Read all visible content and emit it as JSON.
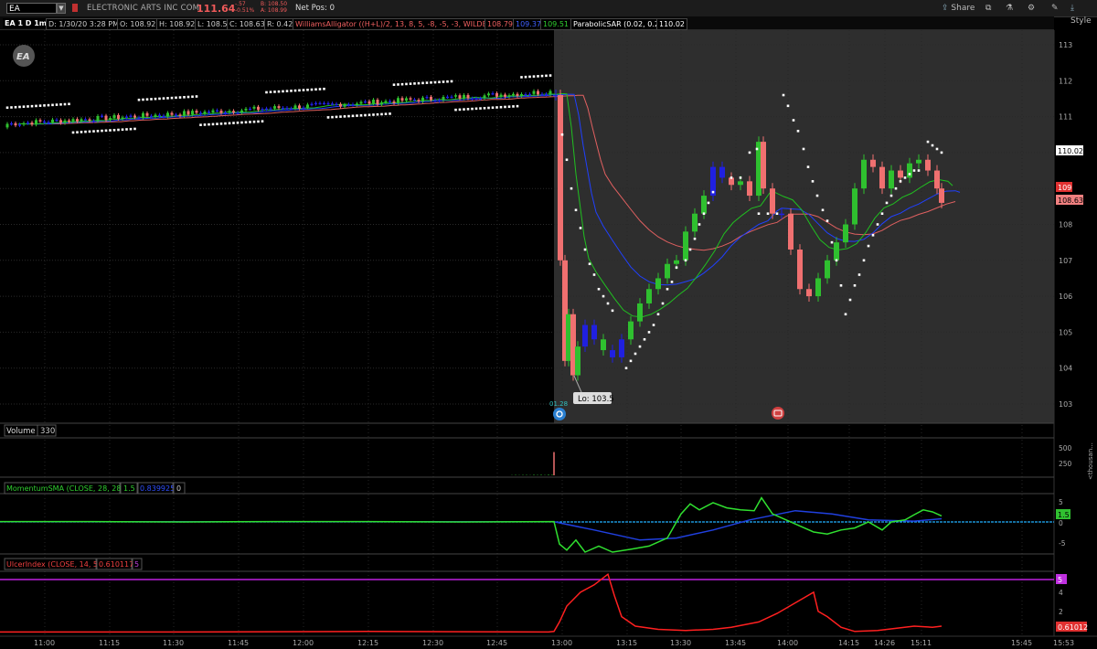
{
  "toolbar": {
    "symbol": "EA",
    "company": "ELECTRONIC ARTS INC COM",
    "last": "111.64",
    "change": "-.57",
    "change_pct": "-0.51%",
    "bid": "B: 108.50",
    "ask": "A: 108.99",
    "net_pos": "Net Pos: 0",
    "share": "Share",
    "style": "Style"
  },
  "status": {
    "chart_label": "EA 1 D 1m",
    "date": "D: 1/30/20 3:28 PM",
    "open": "O: 108.92",
    "high": "H: 108.92",
    "low": "L: 108.5",
    "close": "C: 108.63",
    "range": "R: 0.42",
    "alligator": "WilliamsAlligator ((H+L)/2, 13, 8, 5, -8, -5, -3, WILDERS)",
    "alligator_jaw": "108.79",
    "alligator_teeth": "109.37",
    "alligator_lips": "109.51",
    "psar": "ParabolicSAR (0.02, 0.2)",
    "psar_val": "110.02"
  },
  "price_axis": {
    "ticks": [
      "113",
      "112",
      "111",
      "110",
      "109",
      "108",
      "107",
      "106",
      "105",
      "104",
      "103"
    ],
    "psar_label": "110.02",
    "alligator_label_top": "109",
    "last_label": "108.63"
  },
  "annotations": {
    "low_label": "Lo: 103.5",
    "event_time": "01.28",
    "logo_text": "EA"
  },
  "volume": {
    "title": "Volume",
    "value": "330",
    "ticks": [
      "500",
      "250"
    ],
    "side_label": "<thousan..."
  },
  "momentum": {
    "title": "MomentumSMA (CLOSE, 28, 28)",
    "v1": "1.5",
    "v2": "0.839925",
    "v3": "0",
    "ticks": [
      "5",
      "0",
      "-5"
    ],
    "label": "1.5"
  },
  "ulcer": {
    "title": "UlcerIndex (CLOSE, 14, 5)",
    "v1": "0.610117",
    "v2": "5",
    "ticks": [
      "4",
      "2"
    ],
    "label_top": "5",
    "label_val": "0.61012"
  },
  "time_axis": [
    "11:00",
    "11:15",
    "11:30",
    "11:45",
    "12:00",
    "12:15",
    "12:30",
    "12:45",
    "13:00",
    "13:15",
    "13:30",
    "13:45",
    "14:00",
    "14:15",
    "14:26",
    "15:11",
    "15:45",
    "15:53"
  ],
  "colors": {
    "up": "#2fc02f",
    "down": "#f07070",
    "flat": "#2020e0",
    "jaw": "#e06060",
    "teeth": "#2040ff",
    "lips": "#20c020",
    "psar": "#ffffff",
    "momentum": "#30e030",
    "momentum_sma": "#2040e0",
    "zero": "#20b0ff",
    "ulcer": "#ff2020",
    "ulcer_level": "#c020e0"
  },
  "chart_data": {
    "type": "candlestick",
    "x_labels": [
      "11:00",
      "11:15",
      "11:30",
      "11:45",
      "12:00",
      "12:15",
      "12:30",
      "12:45",
      "13:00",
      "13:15",
      "13:30",
      "13:45",
      "14:00",
      "14:15",
      "14:26",
      "15:11",
      "15:45",
      "15:53"
    ],
    "ylim": [
      102.6,
      113.4
    ],
    "series": [
      {
        "name": "price",
        "values": [
          110.8,
          110.9,
          111.1,
          111.3,
          111.1,
          111.2,
          111.4,
          111.4,
          111.6,
          111.7,
          111.7,
          111.2,
          104.0,
          104.2,
          104.6,
          104.9,
          105.5,
          106.6,
          107.0,
          109.2,
          109.1,
          110.0,
          108.3,
          108.1,
          105.6,
          106.5,
          109.3,
          109.5,
          109.8,
          109.6,
          109.0,
          108.6
        ]
      },
      {
        "name": "WilliamsAlligator",
        "values": [
          108.79,
          109.37,
          109.51
        ]
      },
      {
        "name": "ParabolicSAR",
        "values": [
          110.02
        ]
      }
    ]
  }
}
